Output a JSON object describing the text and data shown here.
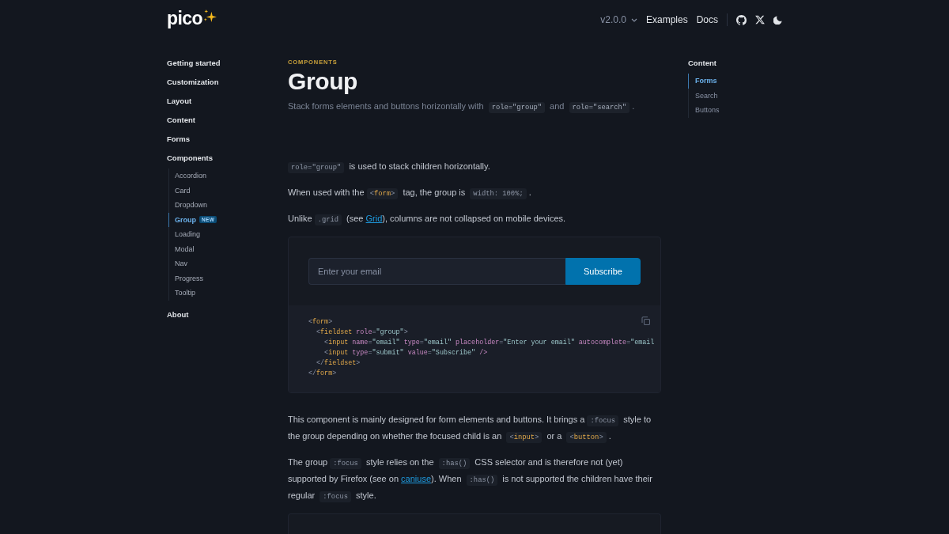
{
  "header": {
    "logo": "pico",
    "version": "v2.0.0",
    "links": [
      "Examples",
      "Docs"
    ]
  },
  "sidebar": {
    "items": [
      {
        "label": "Getting started",
        "selected": false
      },
      {
        "label": "Customization",
        "selected": false
      },
      {
        "label": "Layout",
        "selected": false
      },
      {
        "label": "Content",
        "selected": false
      },
      {
        "label": "Forms",
        "selected": false
      },
      {
        "label": "Components",
        "selected": false,
        "children": [
          {
            "label": "Accordion",
            "selected": false
          },
          {
            "label": "Card",
            "selected": false
          },
          {
            "label": "Dropdown",
            "selected": false
          },
          {
            "label": "Group",
            "selected": true,
            "badge": "NEW"
          },
          {
            "label": "Loading",
            "selected": false
          },
          {
            "label": "Modal",
            "selected": false
          },
          {
            "label": "Nav",
            "selected": false
          },
          {
            "label": "Progress",
            "selected": false
          },
          {
            "label": "Tooltip",
            "selected": false
          }
        ]
      },
      {
        "label": "About",
        "selected": false
      }
    ]
  },
  "page": {
    "eyebrow": "COMPONENTS",
    "title": "Group",
    "subtitle": [
      {
        "kind": "text",
        "text": "Stack forms elements and buttons horizontally with "
      },
      {
        "kind": "code",
        "tokens": [
          {
            "kind": "plain",
            "text": "role=\"group\""
          }
        ]
      },
      {
        "kind": "text",
        "text": " and "
      },
      {
        "kind": "code",
        "tokens": [
          {
            "kind": "plain",
            "text": "role=\"search\""
          }
        ]
      },
      {
        "kind": "text",
        "text": "."
      }
    ]
  },
  "intro": [
    [
      {
        "kind": "code",
        "tokens": [
          {
            "kind": "plain",
            "text": "role=\"group\""
          }
        ]
      },
      {
        "kind": "text",
        "text": " is used to stack children horizontally."
      }
    ],
    [
      {
        "kind": "text",
        "text": "When used with the "
      },
      {
        "kind": "code",
        "tokens": [
          {
            "kind": "punct",
            "text": "<"
          },
          {
            "kind": "tag",
            "text": "form"
          },
          {
            "kind": "punct",
            "text": ">"
          }
        ]
      },
      {
        "kind": "text",
        "text": " tag, the group is "
      },
      {
        "kind": "code",
        "tokens": [
          {
            "kind": "plain",
            "text": "width: 100%;"
          }
        ]
      },
      {
        "kind": "text",
        "text": "."
      }
    ],
    [
      {
        "kind": "text",
        "text": "Unlike "
      },
      {
        "kind": "code",
        "tokens": [
          {
            "kind": "plain",
            "text": ".grid"
          }
        ]
      },
      {
        "kind": "text",
        "text": " (see "
      },
      {
        "kind": "link",
        "text": "Grid"
      },
      {
        "kind": "text",
        "text": "), columns are not collapsed on mobile devices."
      }
    ]
  ],
  "example": {
    "input": {
      "placeholder": "Enter your email"
    },
    "button": "Subscribe",
    "code": [
      {
        "tokens": [
          {
            "kind": "punct",
            "text": "<"
          },
          {
            "kind": "tag",
            "text": "form"
          },
          {
            "kind": "punct",
            "text": ">"
          }
        ],
        "children": [
          {
            "tokens": [
              {
                "kind": "punct",
                "text": "<"
              },
              {
                "kind": "tag",
                "text": "fieldset"
              },
              {
                "kind": "attr",
                "text": " role"
              },
              {
                "kind": "punct",
                "text": "="
              },
              {
                "kind": "string",
                "text": "\"group\""
              },
              {
                "kind": "punct",
                "text": ">"
              }
            ],
            "children": [
              {
                "tokens": [
                  {
                    "kind": "punct",
                    "text": "<"
                  },
                  {
                    "kind": "tag",
                    "text": "input"
                  },
                  {
                    "kind": "attr",
                    "text": " name"
                  },
                  {
                    "kind": "punct",
                    "text": "="
                  },
                  {
                    "kind": "string",
                    "text": "\"email\""
                  },
                  {
                    "kind": "attr",
                    "text": " type"
                  },
                  {
                    "kind": "punct",
                    "text": "="
                  },
                  {
                    "kind": "string",
                    "text": "\"email\""
                  },
                  {
                    "kind": "attr",
                    "text": " placeholder"
                  },
                  {
                    "kind": "punct",
                    "text": "="
                  },
                  {
                    "kind": "string",
                    "text": "\"Enter your email\""
                  },
                  {
                    "kind": "attr",
                    "text": " autocomplete"
                  },
                  {
                    "kind": "punct",
                    "text": "="
                  },
                  {
                    "kind": "string",
                    "text": "\"email"
                  }
                ]
              },
              {
                "tokens": [
                  {
                    "kind": "punct",
                    "text": "<"
                  },
                  {
                    "kind": "tag",
                    "text": "input"
                  },
                  {
                    "kind": "attr",
                    "text": " type"
                  },
                  {
                    "kind": "punct",
                    "text": "="
                  },
                  {
                    "kind": "string",
                    "text": "\"submit\""
                  },
                  {
                    "kind": "attr",
                    "text": " value"
                  },
                  {
                    "kind": "punct",
                    "text": "="
                  },
                  {
                    "kind": "string",
                    "text": "\"Subscribe\""
                  },
                  {
                    "kind": "attr",
                    "text": " />"
                  }
                ]
              }
            ]
          },
          {
            "tokens": [
              {
                "kind": "punct",
                "text": "</"
              },
              {
                "kind": "tag",
                "text": "fieldset"
              },
              {
                "kind": "punct",
                "text": ">"
              }
            ]
          }
        ]
      },
      {
        "tokens": [
          {
            "kind": "punct",
            "text": "</"
          },
          {
            "kind": "tag",
            "text": "form"
          },
          {
            "kind": "punct",
            "text": ">"
          }
        ]
      }
    ]
  },
  "notes": [
    [
      {
        "kind": "text",
        "text": "This component is mainly designed for form elements and buttons. It brings a "
      },
      {
        "kind": "code",
        "tokens": [
          {
            "kind": "plain",
            "text": ":focus"
          }
        ]
      },
      {
        "kind": "text",
        "text": " style to the group depending on whether the focused child is an "
      },
      {
        "kind": "code",
        "tokens": [
          {
            "kind": "punct",
            "text": "<"
          },
          {
            "kind": "tag",
            "text": "input"
          },
          {
            "kind": "punct",
            "text": ">"
          }
        ]
      },
      {
        "kind": "text",
        "text": " or a "
      },
      {
        "kind": "code",
        "tokens": [
          {
            "kind": "punct",
            "text": "<"
          },
          {
            "kind": "tag",
            "text": "button"
          },
          {
            "kind": "punct",
            "text": ">"
          }
        ]
      },
      {
        "kind": "text",
        "text": "."
      }
    ],
    [
      {
        "kind": "text",
        "text": "The group "
      },
      {
        "kind": "code",
        "tokens": [
          {
            "kind": "plain",
            "text": ":focus"
          }
        ]
      },
      {
        "kind": "text",
        "text": " style relies on the "
      },
      {
        "kind": "code",
        "tokens": [
          {
            "kind": "plain",
            "text": ":has()"
          }
        ]
      },
      {
        "kind": "text",
        "text": " CSS selector and is therefore not (yet) supported by Firefox (see on "
      },
      {
        "kind": "link",
        "text": "caniuse"
      },
      {
        "kind": "text",
        "text": "). When "
      },
      {
        "kind": "code",
        "tokens": [
          {
            "kind": "plain",
            "text": ":has()"
          }
        ]
      },
      {
        "kind": "text",
        "text": " is not supported the children have their regular "
      },
      {
        "kind": "code",
        "tokens": [
          {
            "kind": "plain",
            "text": ":focus"
          }
        ]
      },
      {
        "kind": "text",
        "text": " style."
      }
    ]
  ],
  "toc": {
    "title": "Content",
    "items": [
      {
        "label": "Forms",
        "selected": true
      },
      {
        "label": "Search",
        "selected": false
      },
      {
        "label": "Buttons",
        "selected": false
      }
    ]
  }
}
